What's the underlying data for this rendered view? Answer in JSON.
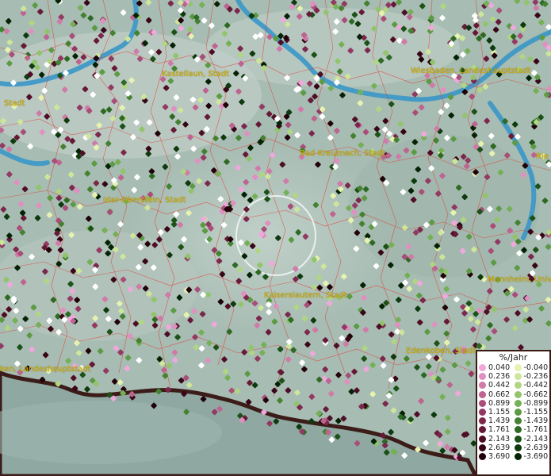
{
  "map": {
    "cities": [
      {
        "label": "Kastellaun, Stadt"
      },
      {
        "label": "Wiesbaden, Landeshauptstadt"
      },
      {
        "label": "Stadt"
      },
      {
        "label": "Bad Kreuznach, Stadt"
      },
      {
        "label": "Rie"
      },
      {
        "label": "Idar-Oberstein, Stadt"
      },
      {
        "label": "Mannheim, Unive"
      },
      {
        "label": "Kaiserslautern, Stadt"
      },
      {
        "label": "Edenkoben, Stadt"
      },
      {
        "label": "ken, Landeshauptstadt"
      }
    ]
  },
  "legend": {
    "title": "%/Jahr",
    "positive": [
      {
        "value": "0.040",
        "color": "#f0a8dc"
      },
      {
        "value": "0.236",
        "color": "#e090c0"
      },
      {
        "value": "0.442",
        "color": "#d07aa8"
      },
      {
        "value": "0.662",
        "color": "#bd6490"
      },
      {
        "value": "0.899",
        "color": "#a84e78"
      },
      {
        "value": "1.155",
        "color": "#923a62"
      },
      {
        "value": "1.439",
        "color": "#7c284c"
      },
      {
        "value": "1.761",
        "color": "#661a38"
      },
      {
        "value": "2.143",
        "color": "#4f0e26"
      },
      {
        "value": "2.639",
        "color": "#380616"
      },
      {
        "value": "3.690",
        "color": "#200208"
      }
    ],
    "negative": [
      {
        "value": "-0.040",
        "color": "#e6f2b0"
      },
      {
        "value": "-0.236",
        "color": "#cde69a"
      },
      {
        "value": "-0.442",
        "color": "#b0d682"
      },
      {
        "value": "-0.662",
        "color": "#92c46c"
      },
      {
        "value": "-0.899",
        "color": "#76b056"
      },
      {
        "value": "-1.155",
        "color": "#5c9a44"
      },
      {
        "value": "-1.439",
        "color": "#448232"
      },
      {
        "value": "-1.761",
        "color": "#2e6a24"
      },
      {
        "value": "-2.143",
        "color": "#1c5218"
      },
      {
        "value": "-2.639",
        "color": "#0e3a0e"
      },
      {
        "value": "-3.690",
        "color": "#042204"
      }
    ]
  }
}
